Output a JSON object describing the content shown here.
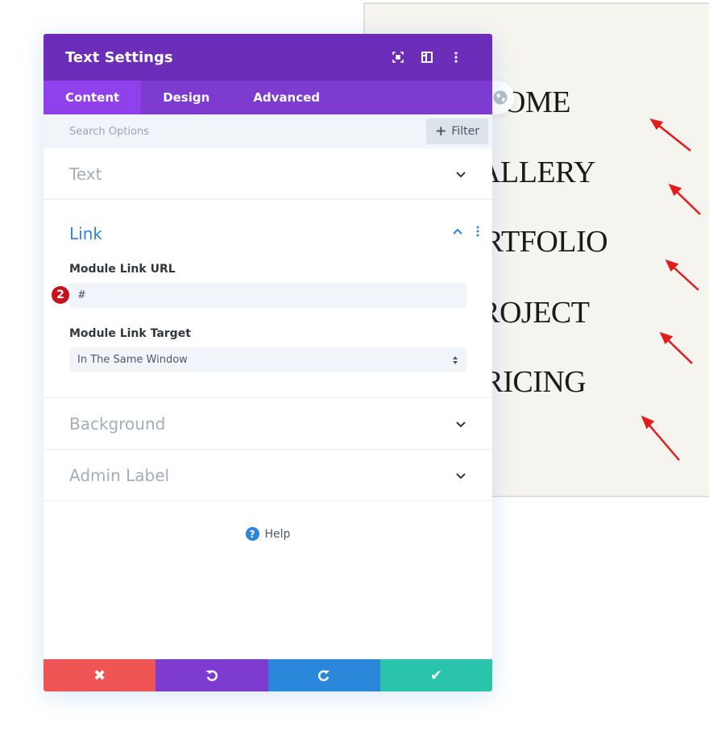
{
  "preview": {
    "nav_items": [
      "HOME",
      "GALLERY",
      "PORTFOLIO",
      "PROJECT",
      "PRICING"
    ],
    "arrow_color": "#e31b1b",
    "background": "#f6f4ef"
  },
  "panel": {
    "title": "Text Settings",
    "header_icons": [
      "focus-icon",
      "split-view-icon",
      "more-vertical-icon"
    ],
    "tabs": [
      {
        "label": "Content",
        "active": true
      },
      {
        "label": "Design",
        "active": false
      },
      {
        "label": "Advanced",
        "active": false
      }
    ],
    "search": {
      "placeholder": "Search Options",
      "filter_label": "Filter"
    },
    "sections": {
      "text": "Text",
      "link": {
        "title": "Link",
        "url_label": "Module Link URL",
        "url_value": "#",
        "step_badge": "2",
        "target_label": "Module Link Target",
        "target_value": "In The Same Window"
      },
      "background": "Background",
      "admin_label": "Admin Label"
    },
    "help_label": "Help",
    "footer": {
      "colors": {
        "cancel": "#ef5555",
        "undo": "#7e3bd0",
        "redo": "#2b87da",
        "save": "#29c4a9"
      }
    }
  },
  "colors": {
    "header": "#6c2eb9",
    "tabs": "#7e3bd0",
    "active_tab": "#8f42ec",
    "link_accent": "#2b87da"
  }
}
